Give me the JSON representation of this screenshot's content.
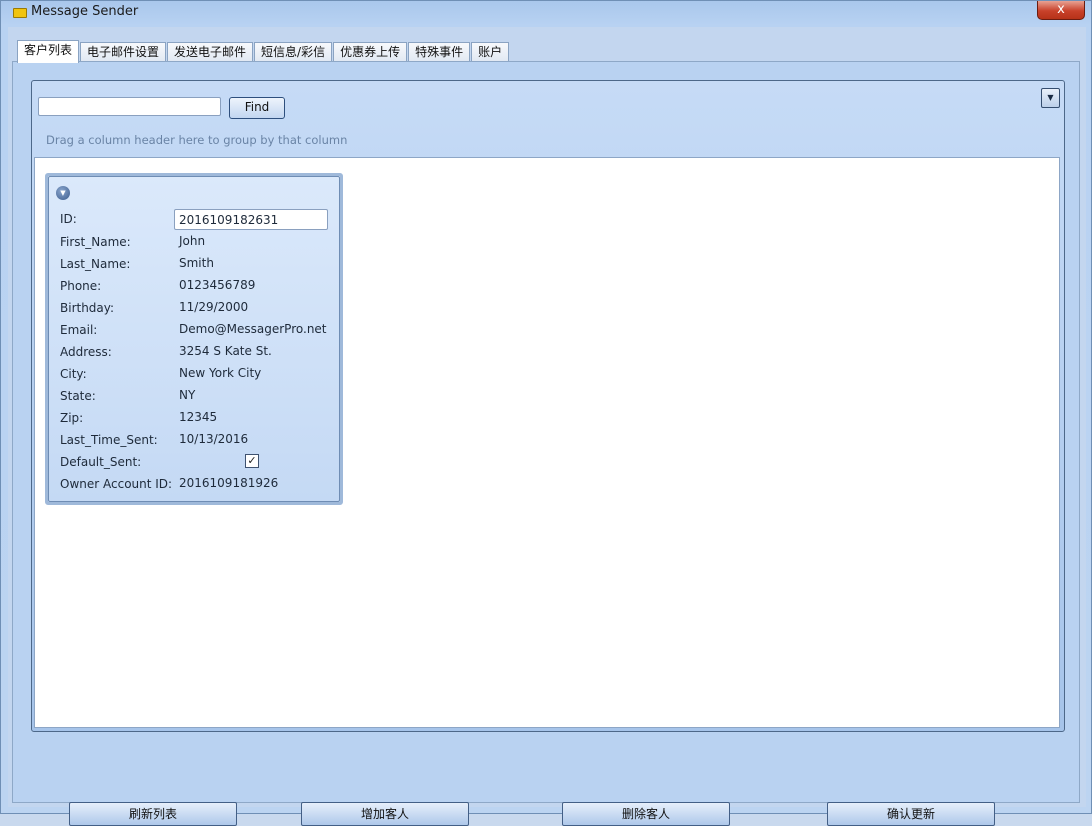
{
  "window": {
    "title": "Message Sender",
    "close_label": "x"
  },
  "tabs": [
    {
      "label": "客户列表",
      "active": true
    },
    {
      "label": "电子邮件设置",
      "active": false
    },
    {
      "label": "发送电子邮件",
      "active": false
    },
    {
      "label": "短信息/彩信",
      "active": false
    },
    {
      "label": "优惠券上传",
      "active": false
    },
    {
      "label": "特殊事件",
      "active": false
    },
    {
      "label": "账户",
      "active": false
    }
  ],
  "toolbar": {
    "search_value": "",
    "find_label": "Find",
    "group_hint": "Drag a column header here to group by that column",
    "dropdown_glyph": "▼"
  },
  "card": {
    "collapse_glyph": "▼",
    "fields": {
      "id": {
        "label": "ID:",
        "value": "2016109182631"
      },
      "first_name": {
        "label": "First_Name:",
        "value": "John"
      },
      "last_name": {
        "label": "Last_Name:",
        "value": "Smith"
      },
      "phone": {
        "label": "Phone:",
        "value": "0123456789"
      },
      "birthday": {
        "label": "Birthday:",
        "value": "11/29/2000"
      },
      "email": {
        "label": "Email:",
        "value": "Demo@MessagerPro.net"
      },
      "address": {
        "label": "Address:",
        "value": "3254 S Kate St."
      },
      "city": {
        "label": "City:",
        "value": "New York City"
      },
      "state": {
        "label": "State:",
        "value": "NY"
      },
      "zip": {
        "label": "Zip:",
        "value": "12345"
      },
      "last_time_sent": {
        "label": "Last_Time_Sent:",
        "value": "10/13/2016"
      },
      "default_sent": {
        "label": "Default_Sent:",
        "checked": true,
        "glyph": "✓"
      },
      "owner_account_id": {
        "label": "Owner Account ID:",
        "value": "2016109181926"
      }
    }
  },
  "buttons": {
    "refresh": "刷新列表",
    "add": "增加客人",
    "delete": "删除客人",
    "confirm": "确认更新"
  }
}
